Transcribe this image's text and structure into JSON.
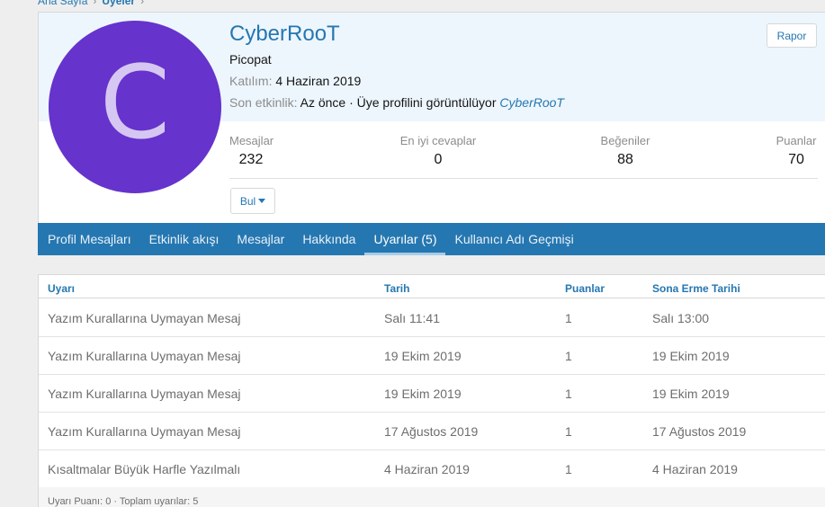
{
  "breadcrumb": {
    "home": "Ana Sayfa",
    "current": "Üyeler"
  },
  "profile": {
    "avatar_letter": "C",
    "username": "CyberRooT",
    "user_title": "Picopat",
    "joined_label": "Katılım:",
    "joined_value": "4 Haziran 2019",
    "last_activity_label": "Son etkinlik:",
    "last_activity_text": "Az önce · Üye profilini görüntülüyor",
    "last_activity_link": "CyberRooT",
    "report_button": "Rapor",
    "find_button": "Bul",
    "stats": [
      {
        "label": "Mesajlar",
        "value": "232"
      },
      {
        "label": "En iyi cevaplar",
        "value": "0"
      },
      {
        "label": "Beğeniler",
        "value": "88"
      },
      {
        "label": "Puanlar",
        "value": "70"
      }
    ]
  },
  "tabs": [
    {
      "label": "Profil Mesajları"
    },
    {
      "label": "Etkinlik akışı"
    },
    {
      "label": "Mesajlar"
    },
    {
      "label": "Hakkında"
    },
    {
      "label": "Uyarılar (5)",
      "active": true
    },
    {
      "label": "Kullanıcı Adı Geçmişi"
    }
  ],
  "warnings": {
    "columns": [
      "Uyarı",
      "Tarih",
      "Puanlar",
      "Sona Erme Tarihi"
    ],
    "rows": [
      [
        "Yazım Kurallarına Uymayan Mesaj",
        "Salı 11:41",
        "1",
        "Salı 13:00"
      ],
      [
        "Yazım Kurallarına Uymayan Mesaj",
        "19 Ekim 2019",
        "1",
        "19 Ekim 2019"
      ],
      [
        "Yazım Kurallarına Uymayan Mesaj",
        "19 Ekim 2019",
        "1",
        "19 Ekim 2019"
      ],
      [
        "Yazım Kurallarına Uymayan Mesaj",
        "17 Ağustos 2019",
        "1",
        "17 Ağustos 2019"
      ],
      [
        "Kısaltmalar Büyük Harfle Yazılmalı",
        "4 Haziran 2019",
        "1",
        "4 Haziran 2019"
      ]
    ],
    "footer": "Uyarı Puanı: 0 · Toplam uyarılar: 5"
  },
  "colors": {
    "accent": "#2577b1",
    "avatar_bg": "#6633cc",
    "header_bg": "#edf6fd"
  }
}
